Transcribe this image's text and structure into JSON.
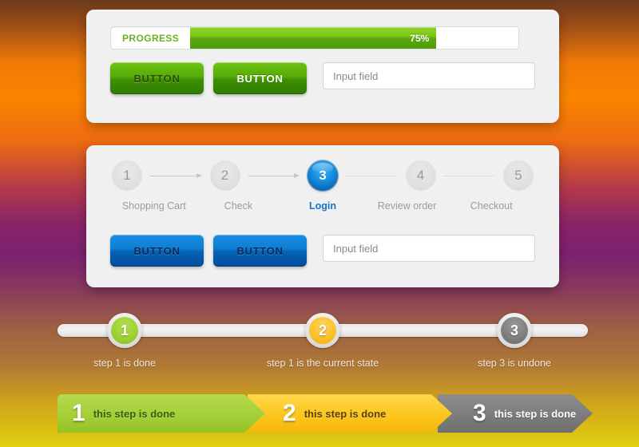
{
  "background": {
    "colors": [
      "#6b3a1d",
      "#fb8500",
      "#8a2468",
      "#9e6342",
      "#e2cf10"
    ]
  },
  "panel_top": {
    "progress": {
      "label": "PROGRESS",
      "value_text": "75%",
      "percent": 75,
      "fill_color": "#7cc71a",
      "label_color": "#6cb025"
    },
    "buttons": [
      {
        "label": "BUTTON",
        "style": "green-dark-text"
      },
      {
        "label": "BUTTON",
        "style": "green-light-text"
      }
    ],
    "input": {
      "value": "",
      "placeholder": "Input field"
    }
  },
  "panel_bottom": {
    "stepper": {
      "steps": [
        {
          "number": "1",
          "label": "Shopping Cart",
          "state": "inactive"
        },
        {
          "number": "2",
          "label": "Check",
          "state": "inactive"
        },
        {
          "number": "3",
          "label": "Login",
          "state": "active"
        },
        {
          "number": "4",
          "label": "Review order",
          "state": "inactive"
        },
        {
          "number": "5",
          "label": "Checkout",
          "state": "inactive"
        }
      ],
      "connectors": [
        "arrow",
        "arrow",
        "dotted",
        "dotted"
      ],
      "active_color": "#1275cc",
      "inactive_color": "#9b9b9b"
    },
    "buttons": [
      {
        "label": "BUTTON",
        "style": "blue"
      },
      {
        "label": "BUTTON",
        "style": "blue"
      }
    ],
    "input": {
      "value": "",
      "placeholder": "Input field"
    }
  },
  "track_section": {
    "nodes": [
      {
        "number": "1",
        "caption": "step 1 is done",
        "state": "done",
        "color": "#9ed233"
      },
      {
        "number": "2",
        "caption": "step 1 is the current state",
        "state": "current",
        "color": "#fcc22c"
      },
      {
        "number": "3",
        "caption": "step 3 is undone",
        "state": "undone",
        "color": "#7f7f7f"
      }
    ]
  },
  "chevron_breadcrumb": {
    "segments": [
      {
        "number": "1",
        "label": "this step is done",
        "color": "#a6d03a"
      },
      {
        "number": "2",
        "label": "this step is done",
        "color": "#fcc821"
      },
      {
        "number": "3",
        "label": "this step is done",
        "color": "#7e7e7e"
      }
    ]
  }
}
